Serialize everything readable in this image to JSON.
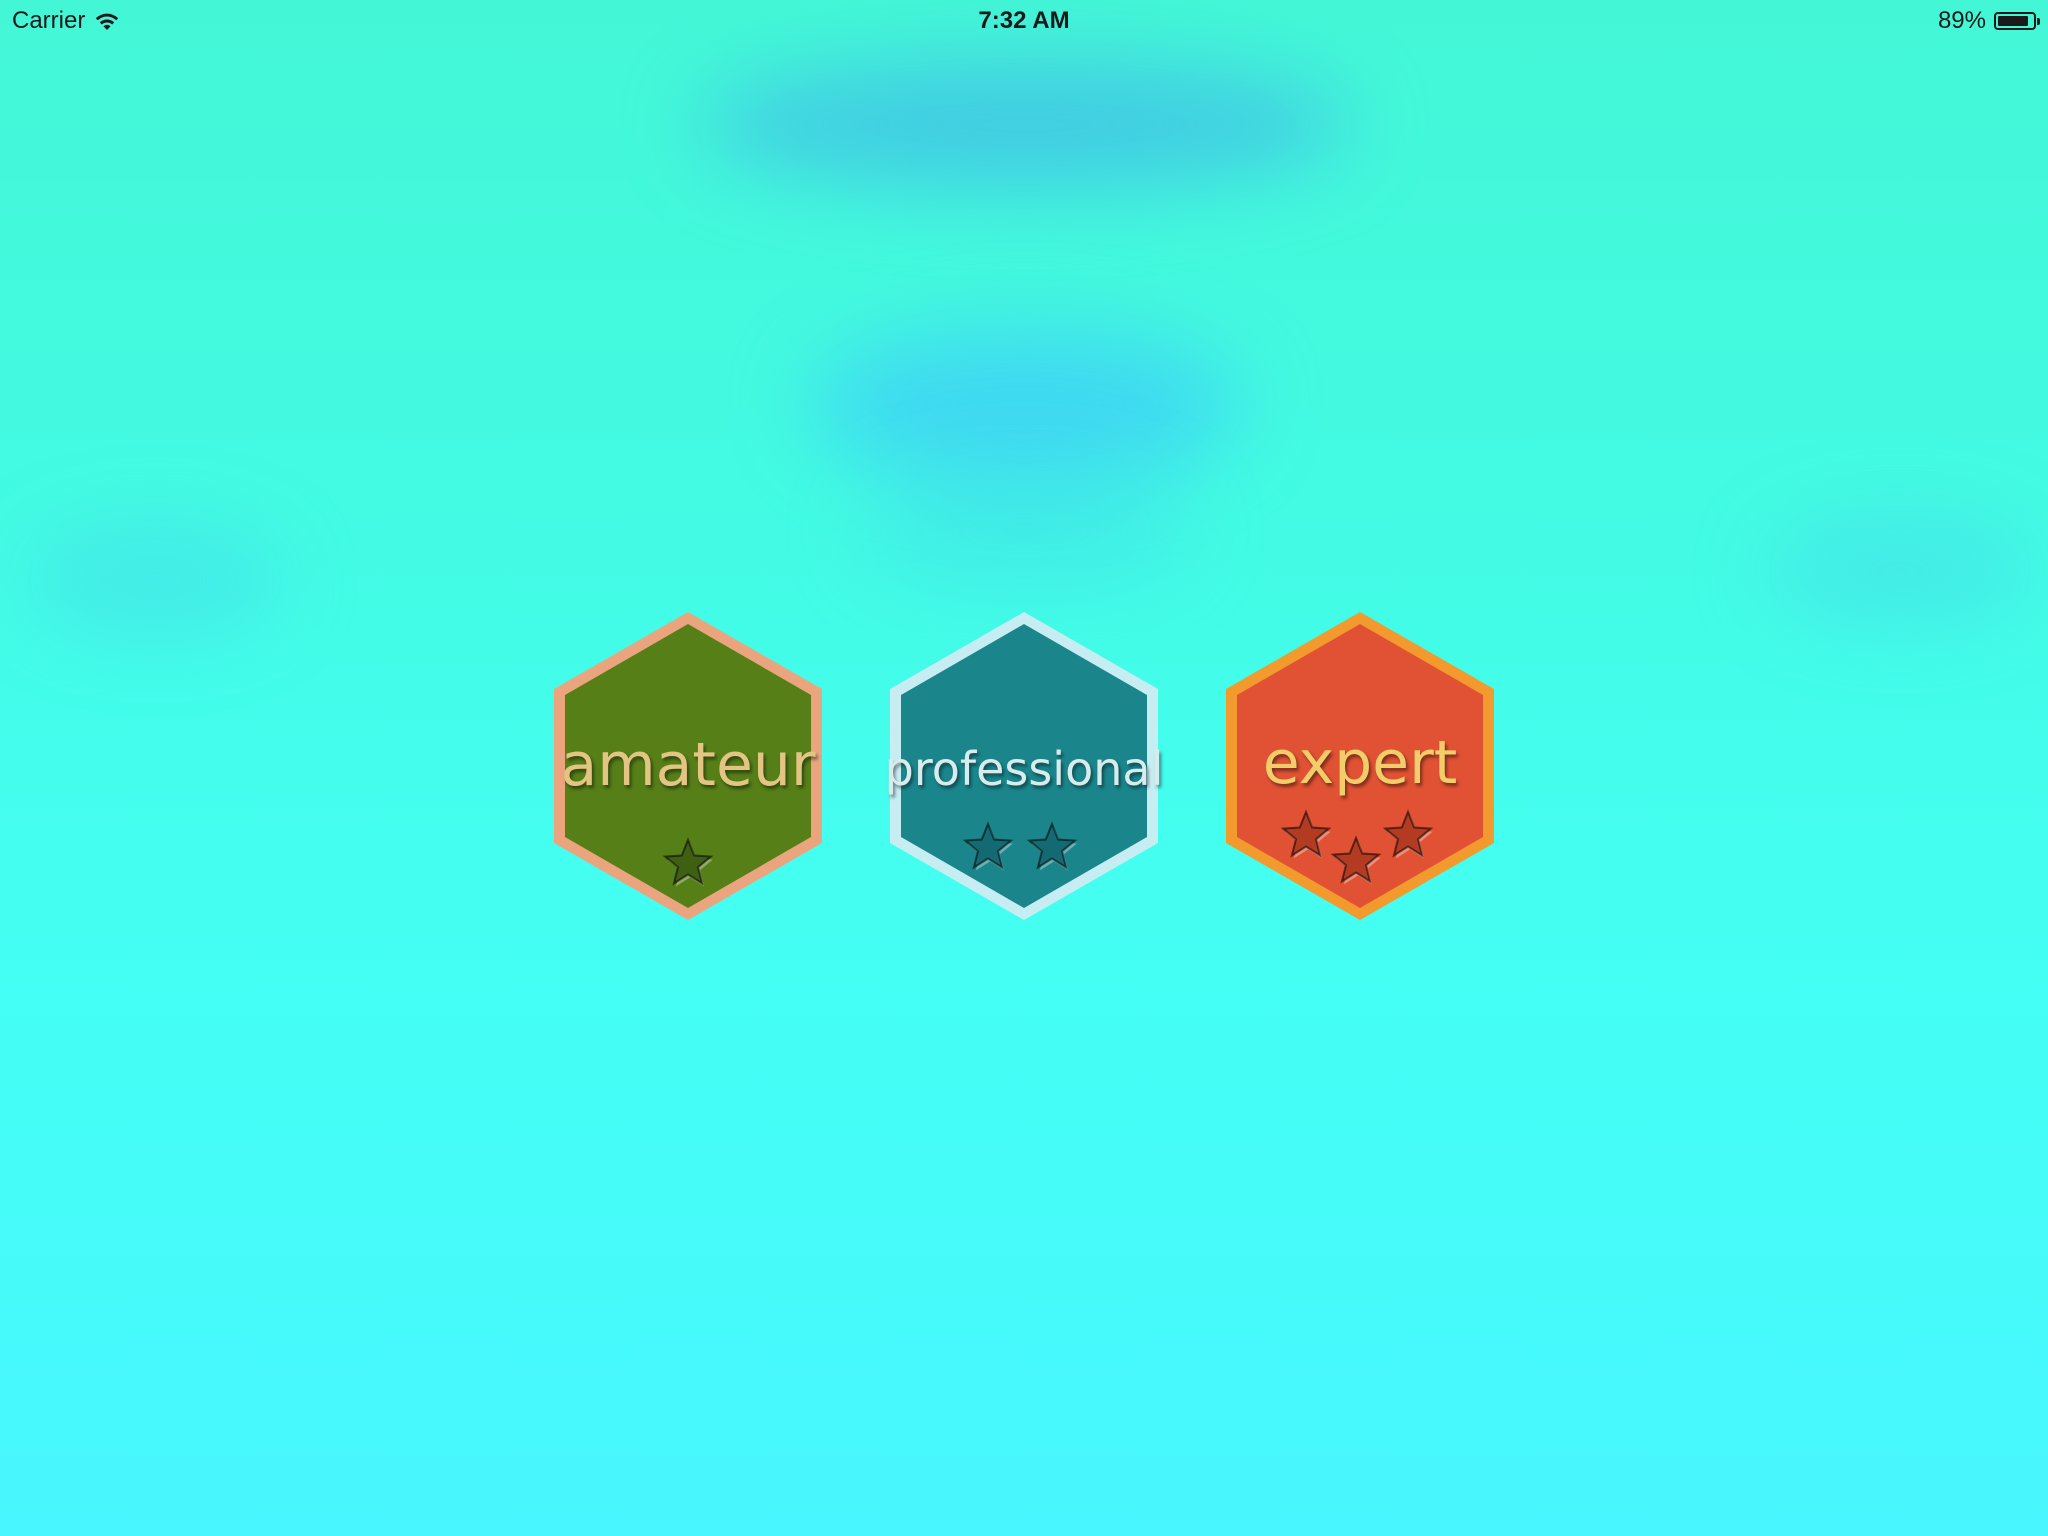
{
  "status_bar": {
    "carrier": "Carrier",
    "time": "7:32 AM",
    "battery_percent": "89%",
    "battery_level": 0.89
  },
  "levels": [
    {
      "label": "amateur",
      "stars": 1,
      "fill_color": "#567f18",
      "border_color": "#eaa57f",
      "text_color": "#e2c483",
      "star_color": "#3f5f12"
    },
    {
      "label": "professional",
      "stars": 2,
      "fill_color": "#1a868c",
      "border_color": "#c6eef2",
      "text_color": "#d9eced",
      "star_color": "#146a72"
    },
    {
      "label": "expert",
      "stars": 3,
      "fill_color": "#e05233",
      "border_color": "#f29a2e",
      "text_color": "#f2cd6a",
      "star_color": "#b23b22"
    }
  ]
}
